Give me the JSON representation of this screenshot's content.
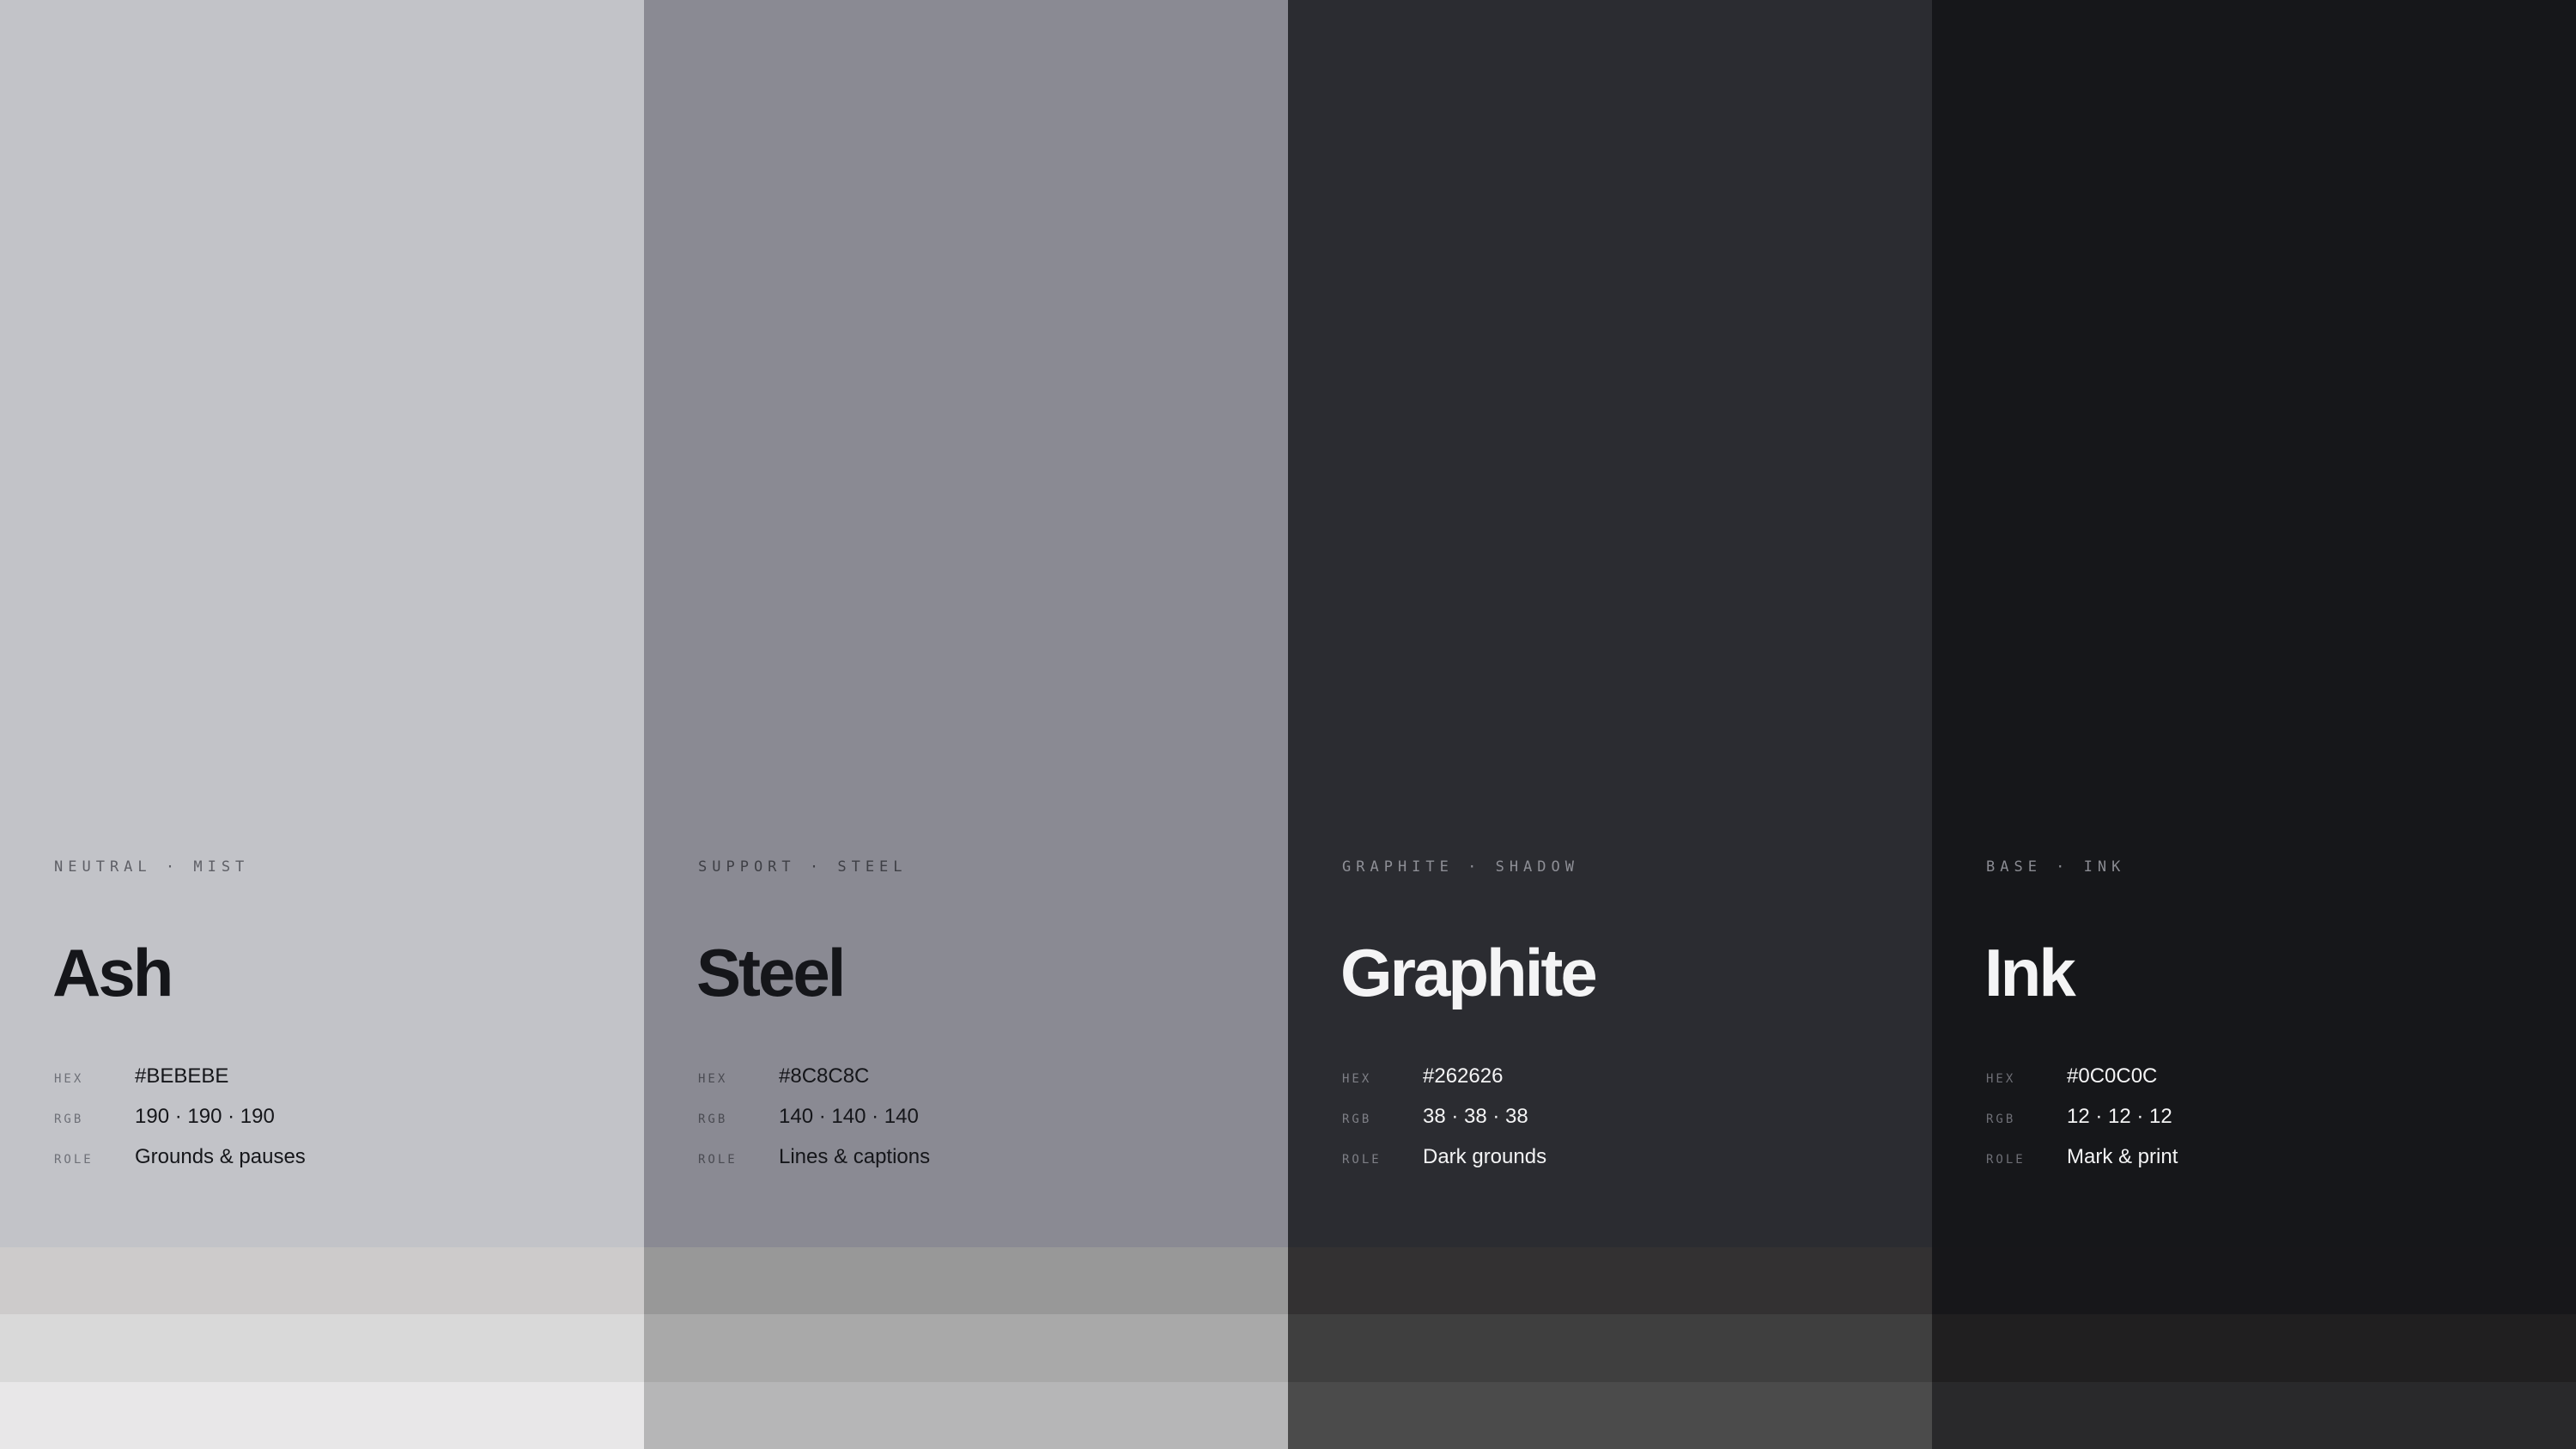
{
  "labels": {
    "hex": "HEX",
    "rgb": "RGB",
    "role": "ROLE"
  },
  "swatches": [
    {
      "eyebrow": "NEUTRAL · MIST",
      "name": "Ash",
      "hex": "#BEBEBE",
      "rgb": "190 · 190 · 190",
      "role": "Grounds & pauses",
      "colors": {
        "fill": "#C2C3C8",
        "tints": [
          "#CDCBCB",
          "#D9D9D9",
          "#E8E7E8"
        ],
        "eyebrow": "#5E5F66",
        "name": "#15161A",
        "label": "#6E7078",
        "value": "#15161A"
      }
    },
    {
      "eyebrow": "SUPPORT · STEEL",
      "name": "Steel",
      "hex": "#8C8C8C",
      "rgb": "140 · 140 · 140",
      "role": "Lines & captions",
      "colors": {
        "fill": "#8A8A93",
        "tints": [
          "#989898",
          "#A9A9A9",
          "#B6B6B7"
        ],
        "eyebrow": "#3E3F45",
        "name": "#15161A",
        "label": "#4A4B52",
        "value": "#15161A"
      }
    },
    {
      "eyebrow": "GRAPHITE · SHADOW",
      "name": "Graphite",
      "hex": "#262626",
      "rgb": "38 · 38 · 38",
      "role": "Dark grounds",
      "colors": {
        "fill": "#2B2C31",
        "tints": [
          "#333132",
          "#3F3F3F",
          "#4B4B4B"
        ],
        "eyebrow": "#8E8F96",
        "name": "#F4F4F5",
        "label": "#7E7F86",
        "value": "#F4F4F5"
      }
    },
    {
      "eyebrow": "BASE · INK",
      "name": "Ink",
      "hex": "#0C0C0C",
      "rgb": "12 · 12 · 12",
      "role": "Mark & print",
      "colors": {
        "fill": "#16171A",
        "tints": [
          "#17171A",
          "#201F20",
          "#29292B"
        ],
        "eyebrow": "#8A8B92",
        "name": "#F4F4F5",
        "label": "#6E6F76",
        "value": "#F4F4F5"
      }
    }
  ]
}
